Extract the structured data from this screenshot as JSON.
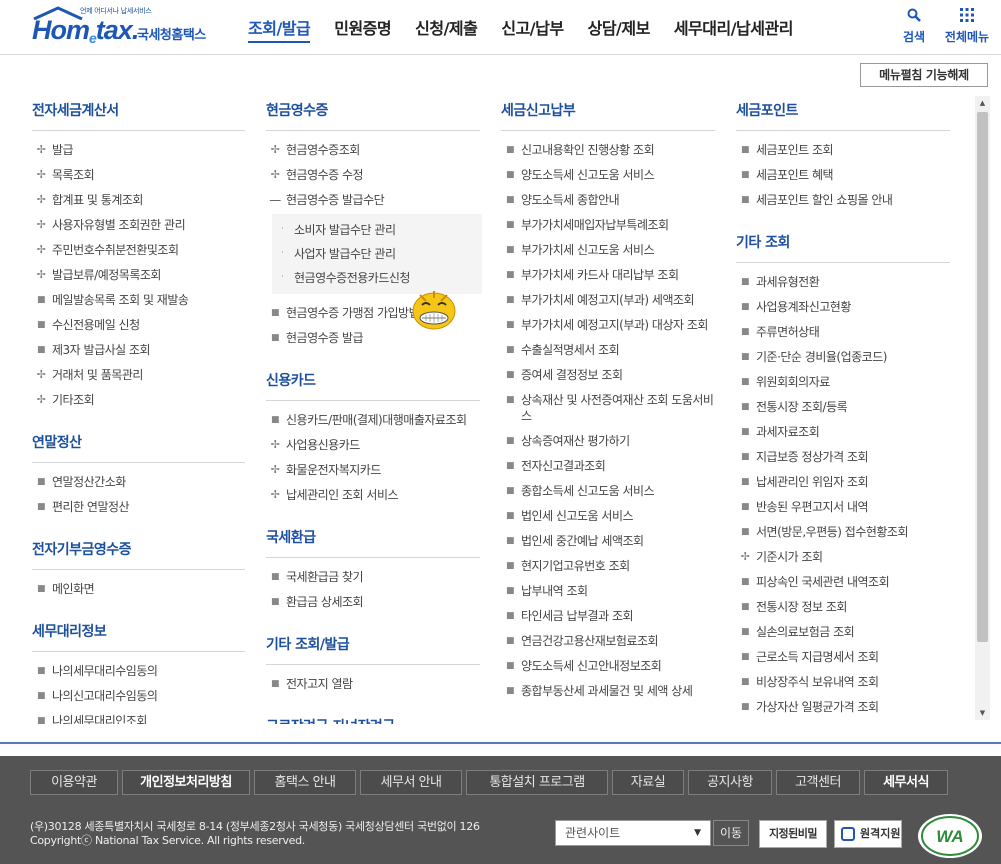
{
  "header": {
    "logo_tagline": "언제 어디서나 납세서비스",
    "logo_word_left": "Hom",
    "logo_word_e": "e",
    "logo_word_right": "tax.",
    "logo_kor": "국세청홈택스",
    "gnb": [
      "조회/발급",
      "민원증명",
      "신청/제출",
      "신고/납부",
      "상담/제보",
      "세무대리/납세관리"
    ],
    "search_label": "검색",
    "allmenu_label": "전체메뉴"
  },
  "menu_release_label": "메뉴펼침 기능해제",
  "col1": {
    "s1": {
      "title": "전자세금계산서",
      "items": [
        "발급",
        "목록조회",
        "합계표 및 통계조회",
        "사용자유형별 조회권한 관리",
        "주민번호수취분전환및조회",
        "발급보류/예정목록조회",
        "메일발송목록 조회 및 재발송",
        "수신전용메일 신청",
        "제3자 발급사실 조회",
        "거래처 및 품목관리",
        "기타조회"
      ]
    },
    "s2": {
      "title": "연말정산",
      "items": [
        "연말정산간소화",
        "편리한 연말정산"
      ]
    },
    "s3": {
      "title": "전자기부금영수증",
      "items": [
        "메인화면"
      ]
    },
    "s4": {
      "title": "세무대리정보",
      "items": [
        "나의세무대리수임동의",
        "나의신고대리수임동의",
        "나의세무대리인조회"
      ]
    }
  },
  "col2": {
    "s1": {
      "title": "현금영수증",
      "items": [
        "현금영수증조회",
        "현금영수증 수정",
        "현금영수증 발급수단"
      ],
      "sub": [
        "소비자 발급수단 관리",
        "사업자 발급수단 관리",
        "현금영수증전용카드신청"
      ],
      "items_after": [
        "현금영수증 가맹점 가입방법",
        "현금영수증 발급"
      ]
    },
    "s2": {
      "title": "신용카드",
      "items": [
        "신용카드/판매(결제)대행매출자료조회",
        "사업용신용카드",
        "화물운전자복지카드",
        "납세관리인 조회 서비스"
      ]
    },
    "s3": {
      "title": "국세환급",
      "items": [
        "국세환급금 찾기",
        "환급금 상세조회"
      ]
    },
    "s4": {
      "title": "기타 조회/발급",
      "items": [
        "전자고지 열람"
      ]
    },
    "s5": {
      "title": "근로장려금.자녀장려금",
      "items": []
    }
  },
  "col3": {
    "s1": {
      "title": "세금신고납부",
      "items": [
        "신고내용확인 진행상황 조회",
        "양도소득세 신고도움 서비스",
        "양도소득세 종합안내",
        "부가가치세매입자납부특례조회",
        "부가가치세 신고도움 서비스",
        "부가가치세 카드사 대리납부 조회",
        "부가가치세 예정고지(부과) 세액조회",
        "부가가치세 예정고지(부과) 대상자 조회",
        "수출실적명세서 조회",
        "증여세 결정정보 조회",
        "상속재산 및 사전증여재산 조회 도움서비스",
        "상속증여재산 평가하기",
        "전자신고결과조회",
        "종합소득세 신고도움 서비스",
        "법인세 신고도움 서비스",
        "법인세 중간예납 세액조회",
        "현지기업고유번호 조회",
        "납부내역 조회",
        "타인세금 납부결과 조회",
        "연금건강고용산재보험료조회",
        "양도소득세 신고안내정보조회",
        "종합부동산세 과세물건 및 세액 상세"
      ]
    }
  },
  "col4": {
    "s1": {
      "title": "세금포인트",
      "items": [
        "세금포인트 조회",
        "세금포인트 혜택",
        "세금포인트 할인 쇼핑몰 안내"
      ]
    },
    "s2": {
      "title": "기타 조회",
      "items": [
        "과세유형전환",
        "사업용계좌신고현황",
        "주류면허상태",
        "기준·단순 경비율(업종코드)",
        "위원회회의자료",
        "전통시장 조회/등록",
        "과세자료조회",
        "지급보증 정상가격 조회",
        "납세관리인 위임자 조회",
        "반송된 우편고지서 내역",
        "서면(방문,우편등) 접수현황조회",
        "기준시가 조회",
        "피상속인 국세관련 내역조회",
        "전통시장 정보 조회",
        "실손의료보험금 조회",
        "근로소득 지급명세서 조회",
        "비상장주식 보유내역 조회",
        "가상자산 일평균가격 조회"
      ]
    }
  },
  "footer": {
    "links": [
      "이용약관",
      "개인정보처리방침",
      "홈택스 안내",
      "세무서 안내",
      "통합설치 프로그램",
      "자료실",
      "공지사항",
      "고객센터",
      "세무서식"
    ],
    "address": "(우)30128 세종특별자치시 국세청로 8-14 (정부세종2청사 국세청동) 국세청상담센터 국번없이 126",
    "copyright": "Copyrightⓒ National Tax Service. All rights reserved.",
    "related_label": "관련사이트",
    "move_label": "이동",
    "policy_label": "지정된비밀",
    "remote_label": "원격지원",
    "wa_label": "WA"
  }
}
